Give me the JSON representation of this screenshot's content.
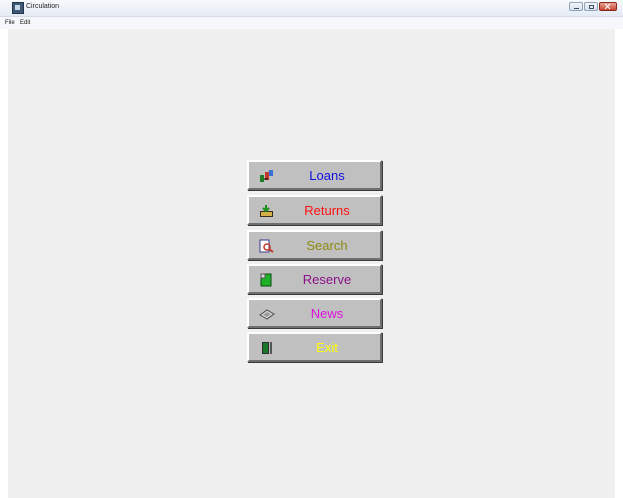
{
  "window": {
    "title": "Circulation"
  },
  "menu": {
    "items": [
      "File",
      "Edit"
    ]
  },
  "buttons": [
    {
      "id": "loans",
      "label": "Loans",
      "color": "#1010e0",
      "icon": "loans-icon"
    },
    {
      "id": "returns",
      "label": "Returns",
      "color": "#ff1010",
      "icon": "returns-icon"
    },
    {
      "id": "search",
      "label": "Search",
      "color": "#8a8a10",
      "icon": "search-icon"
    },
    {
      "id": "reserve",
      "label": "Reserve",
      "color": "#8a108a",
      "icon": "reserve-icon"
    },
    {
      "id": "news",
      "label": "News",
      "color": "#e010e0",
      "icon": "news-icon"
    },
    {
      "id": "exit",
      "label": "Exit",
      "color": "#ffff00",
      "icon": "exit-icon"
    }
  ]
}
